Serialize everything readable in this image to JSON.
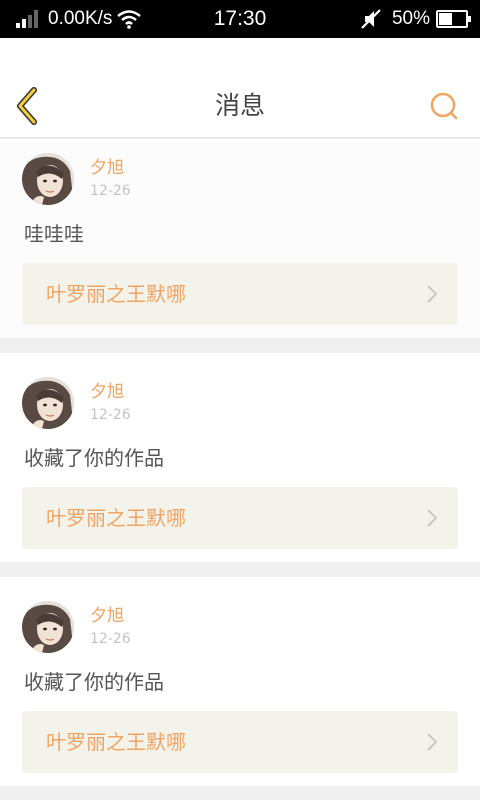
{
  "status_bar": {
    "net_speed": "0.00K/s",
    "time": "17:30",
    "battery": "50%",
    "battery_level": 0.5
  },
  "header": {
    "title": "消息",
    "back_icon": "chevron-left-icon",
    "search_icon": "search-icon"
  },
  "colors": {
    "accent": "#f0a462",
    "back_arrow": "#f2cf3a"
  },
  "messages": [
    {
      "user": "夕旭",
      "date": "12-26",
      "text": "哇哇哇",
      "work": "叶罗丽之王默哪"
    },
    {
      "user": "夕旭",
      "date": "12-26",
      "text": "收藏了你的作品",
      "work": "叶罗丽之王默哪"
    },
    {
      "user": "夕旭",
      "date": "12-26",
      "text": "收藏了你的作品",
      "work": "叶罗丽之王默哪"
    }
  ]
}
